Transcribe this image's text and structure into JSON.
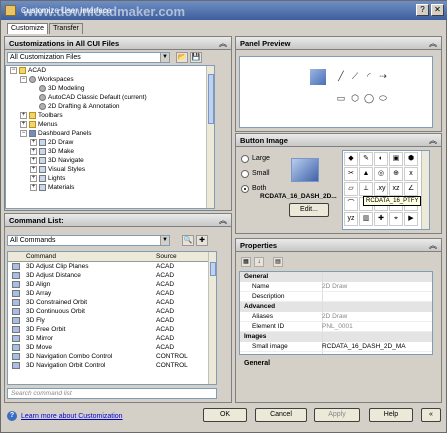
{
  "window": {
    "title": "Customize User Interface",
    "watermark": "www.downloadmaker.com"
  },
  "tabs": [
    "Customize",
    "Transfer"
  ],
  "cui_panel": {
    "title": "Customizations in All CUI Files",
    "filter_value": "All Customization Files",
    "tree": [
      {
        "label": "ACAD",
        "icon": "folder-icon",
        "level": 0,
        "expanded": true
      },
      {
        "label": "Workspaces",
        "icon": "gear-icon",
        "level": 1,
        "expanded": true
      },
      {
        "label": "3D Modeling",
        "icon": "gear-icon",
        "level": 2
      },
      {
        "label": "AutoCAD Classic Default (current)",
        "icon": "gear-icon",
        "level": 2
      },
      {
        "label": "2D Drafting & Annotation",
        "icon": "gear-icon",
        "level": 2
      },
      {
        "label": "Toolbars",
        "icon": "folder-icon",
        "level": 1,
        "expanded": false
      },
      {
        "label": "Menus",
        "icon": "folder-icon",
        "level": 1,
        "expanded": false
      },
      {
        "label": "Dashboard Panels",
        "icon": "dashboard-icon",
        "level": 1,
        "expanded": true
      },
      {
        "label": "2D Draw",
        "icon": "panel-icon",
        "level": 2,
        "expanded": false
      },
      {
        "label": "3D Make",
        "icon": "panel-icon",
        "level": 2,
        "expanded": false
      },
      {
        "label": "3D Navigate",
        "icon": "panel-icon",
        "level": 2,
        "expanded": false
      },
      {
        "label": "Visual Styles",
        "icon": "panel-icon",
        "level": 2,
        "expanded": false
      },
      {
        "label": "Lights",
        "icon": "panel-icon",
        "level": 2,
        "expanded": false
      },
      {
        "label": "Materials",
        "icon": "panel-icon",
        "level": 2,
        "expanded": false
      }
    ]
  },
  "command_list": {
    "title": "Command List:",
    "filter_value": "All Commands",
    "columns": [
      "Command",
      "Source"
    ],
    "rows": [
      [
        "3D Adjust Clip Planes",
        "ACAD"
      ],
      [
        "3D Adjust Distance",
        "ACAD"
      ],
      [
        "3D Align",
        "ACAD"
      ],
      [
        "3D Array",
        "ACAD"
      ],
      [
        "3D Constrained Orbit",
        "ACAD"
      ],
      [
        "3D Continuous Orbit",
        "ACAD"
      ],
      [
        "3D Fly",
        "ACAD"
      ],
      [
        "3D Free Orbit",
        "ACAD"
      ],
      [
        "3D Mirror",
        "ACAD"
      ],
      [
        "3D Move",
        "ACAD"
      ],
      [
        "3D Navigation Combo Control",
        "CONTROL"
      ],
      [
        "3D Navigation Orbit Control",
        "CONTROL"
      ]
    ],
    "search_placeholder": "Search command list"
  },
  "panel_preview": {
    "title": "Panel Preview"
  },
  "button_image": {
    "title": "Button Image",
    "options": [
      "Large",
      "Small",
      "Both"
    ],
    "selected": "Both",
    "image_name": "RCDATA_16_DASH_2D...",
    "edit_label": "Edit...",
    "tooltip": "RCDATA_16_PTFY"
  },
  "properties": {
    "title": "Properties",
    "categories": [
      {
        "name": "General",
        "rows": [
          [
            "Name",
            "2D Draw"
          ],
          [
            "Description",
            ""
          ]
        ]
      },
      {
        "name": "Advanced",
        "rows": [
          [
            "Aliases",
            "2D Draw"
          ],
          [
            "Element ID",
            "PNL_0001"
          ]
        ]
      },
      {
        "name": "Images",
        "rows": [
          [
            "Small image",
            "RCDATA_16_DASH_2D_MA"
          ]
        ]
      }
    ],
    "footer_label": "General"
  },
  "footer": {
    "link": "Learn more about Customization",
    "ok": "OK",
    "cancel": "Cancel",
    "apply": "Apply",
    "help": "Help"
  }
}
